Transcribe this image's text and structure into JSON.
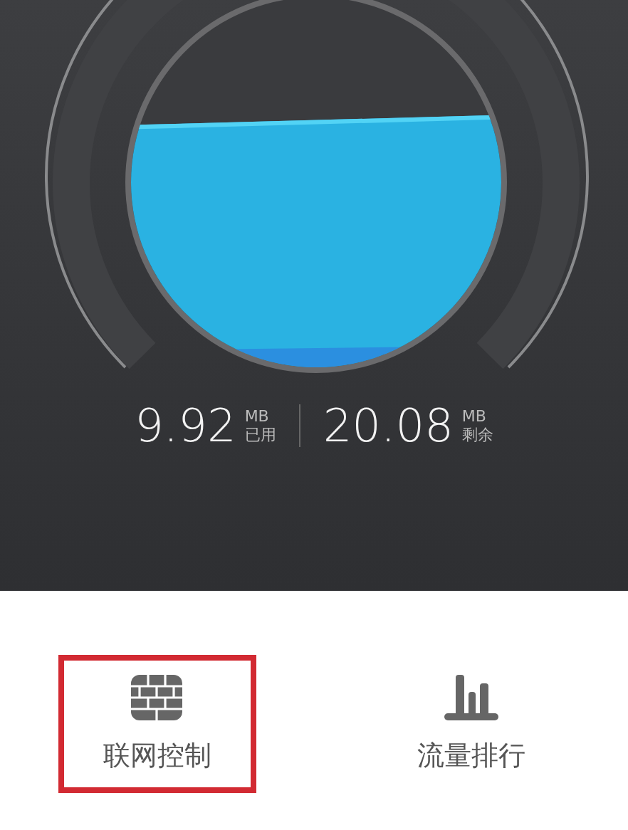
{
  "readings": [
    {
      "value": "9.92",
      "unit": "MB",
      "label": "已用"
    },
    {
      "value": "20.08",
      "unit": "MB",
      "label": "剩余"
    }
  ],
  "actions": [
    {
      "label": "联网控制",
      "kind": "wall",
      "highlighted": true
    },
    {
      "label": "流量排行",
      "kind": "bars",
      "highlighted": false
    }
  ]
}
